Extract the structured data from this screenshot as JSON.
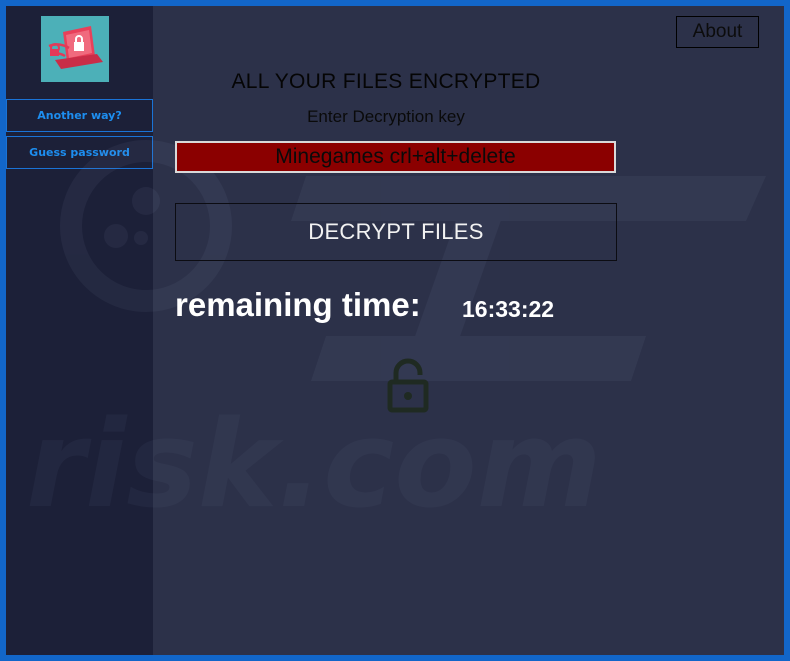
{
  "sidebar": {
    "logo_icon": "ransomware-laptop-lock-icon",
    "buttons": [
      {
        "label": "Another way?"
      },
      {
        "label": "Guess password"
      }
    ]
  },
  "header": {
    "about_label": "About",
    "title": "ALL YOUR FILES ENCRYPTED",
    "subtitle": "Enter Decryption key"
  },
  "decryption": {
    "key_value": "Minegames crl+alt+delete",
    "decrypt_label": "DECRYPT FILES"
  },
  "timer": {
    "label": "remaining time:",
    "value": "16:33:22"
  },
  "watermark_text": "risk.com",
  "colors": {
    "window_border": "#1266c9",
    "background": "#2c3149",
    "sidebar": "#1c2038",
    "sidebar_button_text": "#1d8ef0",
    "key_input_bg": "#8b0000",
    "logo_bg": "#4cb0b8",
    "lock_icon": "#1f2a22"
  },
  "icons": {
    "lock": "padlock-icon"
  }
}
